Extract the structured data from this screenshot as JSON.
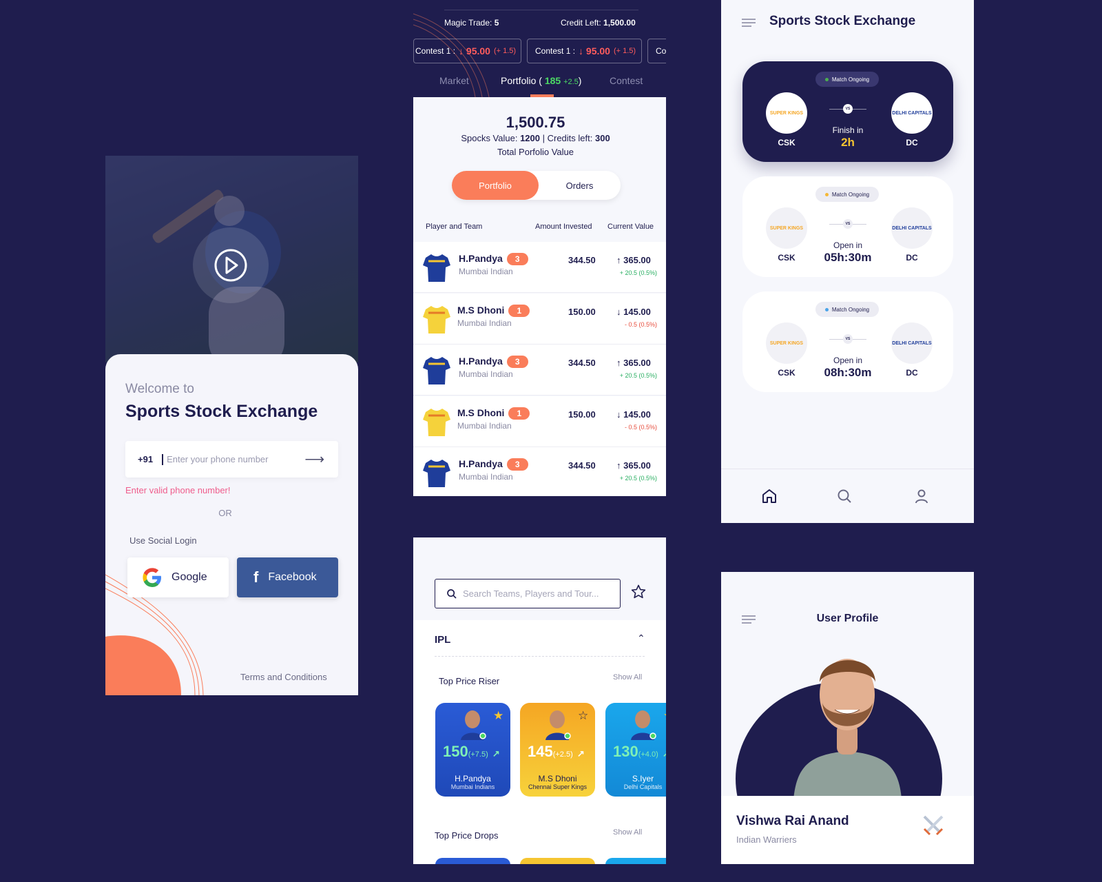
{
  "login": {
    "welcome": "Welcome to",
    "app_name": "Sports Stock Exchange",
    "country_code": "+91",
    "phone_placeholder": "Enter your phone number",
    "error": "Enter valid phone number!",
    "or": "OR",
    "social_label": "Use Social Login",
    "google": "Google",
    "facebook": "Facebook",
    "terms": "Terms and Conditions"
  },
  "portfolio": {
    "magic_trade_label": "Magic Trade:",
    "magic_trade_value": "5",
    "credit_left_label": "Credit Left:",
    "credit_left_value": "1,500.00",
    "contests": [
      {
        "label": "Contest 1 :",
        "value": "95.00",
        "change": "(+ 1.5)"
      },
      {
        "label": "Contest 1 :",
        "value": "95.00",
        "change": "(+ 1.5)"
      },
      {
        "label": "Co"
      }
    ],
    "tabs": {
      "market": "Market",
      "portfolio": "Portfolio (",
      "portfolio_count": "185",
      "portfolio_change": "+2.5",
      "portfolio_close": ")",
      "contest": "Contest"
    },
    "total": "1,500.75",
    "spocks_label": "Spocks Value:",
    "spocks_value": "1200",
    "credits_label": "| Credits left:",
    "credits_value": "300",
    "total_label": "Total Porfolio Value",
    "toggle": {
      "portfolio": "Portfolio",
      "orders": "Orders"
    },
    "headers": {
      "player": "Player and Team",
      "invested": "Amount Invested",
      "current": "Current Value"
    },
    "rows": [
      {
        "name": "H.Pandya",
        "badge": "3",
        "team": "Mumbai Indian",
        "invested": "344.50",
        "arrow": "↑",
        "current": "365.00",
        "change": "+ 20.5 (0.5%)",
        "up": true
      },
      {
        "name": "M.S Dhoni",
        "badge": "1",
        "team": "Mumbai Indian",
        "invested": "150.00",
        "arrow": "↓",
        "current": "145.00",
        "change": "- 0.5 (0.5%)",
        "up": false
      },
      {
        "name": "H.Pandya",
        "badge": "3",
        "team": "Mumbai Indian",
        "invested": "344.50",
        "arrow": "↑",
        "current": "365.00",
        "change": "+ 20.5 (0.5%)",
        "up": true
      },
      {
        "name": "M.S Dhoni",
        "badge": "1",
        "team": "Mumbai Indian",
        "invested": "150.00",
        "arrow": "↓",
        "current": "145.00",
        "change": "- 0.5 (0.5%)",
        "up": false
      },
      {
        "name": "H.Pandya",
        "badge": "3",
        "team": "Mumbai Indian",
        "invested": "344.50",
        "arrow": "↑",
        "current": "365.00",
        "change": "+ 20.5 (0.5%)",
        "up": true
      }
    ]
  },
  "matches": {
    "title": "Sports Stock Exchange",
    "cards": [
      {
        "status": "Match Ongoing",
        "dot": "#4caf50",
        "team_a": "CSK",
        "team_b": "DC",
        "vs": "VS",
        "timer_label": "Finish in",
        "timer": "2h",
        "dark": true
      },
      {
        "status": "Match Ongoing",
        "dot": "#f5b836",
        "team_a": "CSK",
        "team_b": "DC",
        "vs": "VS",
        "timer_label": "Open in",
        "timer": "05h:30m",
        "dark": false
      },
      {
        "status": "Match Ongoing",
        "dot": "#4aa3e8",
        "team_a": "CSK",
        "team_b": "DC",
        "vs": "VS",
        "timer_label": "Open in",
        "timer": "08h:30m",
        "dark": false
      }
    ],
    "logos": {
      "csk": "SUPER KINGS",
      "dc": "DELHI CAPITALS"
    }
  },
  "search": {
    "placeholder": "Search Teams, Players and Tour...",
    "league": "IPL",
    "risers_title": "Top Price Riser",
    "show_all": "Show All",
    "drops_title": "Top Price Drops",
    "cards": [
      {
        "price": "150",
        "change": "(+7.5)",
        "name": "H.Pandya",
        "team": "Mumbai Indians",
        "color_top": "#2a5bd6",
        "color_bottom": "#1f49b8",
        "starred": true
      },
      {
        "price": "145",
        "change": "(+2.5)",
        "name": "M.S Dhoni",
        "team": "Chennai Super Kings",
        "color_top": "#f5a623",
        "color_bottom": "#f7d23b",
        "starred": false
      },
      {
        "price": "130",
        "change": "(+4.0)",
        "name": "S.Iyer",
        "team": "Delhi Capitals",
        "color_top": "#1aa7ec",
        "color_bottom": "#1389d6",
        "starred": true
      }
    ]
  },
  "profile": {
    "title": "User Profile",
    "name": "Vishwa Rai Anand",
    "team": "Indian Warriers"
  }
}
